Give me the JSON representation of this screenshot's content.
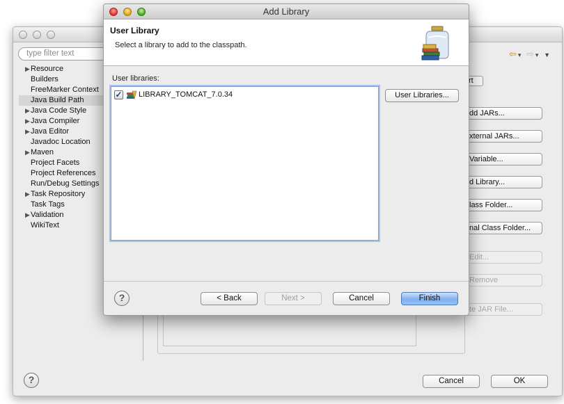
{
  "background_window": {
    "filter_placeholder": "type filter text",
    "tree": [
      {
        "label": "Resource",
        "expandable": true
      },
      {
        "label": "Builders",
        "expandable": false
      },
      {
        "label": "FreeMarker Context",
        "expandable": false
      },
      {
        "label": "Java Build Path",
        "expandable": false,
        "selected": true
      },
      {
        "label": "Java Code Style",
        "expandable": true
      },
      {
        "label": "Java Compiler",
        "expandable": true
      },
      {
        "label": "Java Editor",
        "expandable": true
      },
      {
        "label": "Javadoc Location",
        "expandable": false
      },
      {
        "label": "Maven",
        "expandable": true
      },
      {
        "label": "Project Facets",
        "expandable": false
      },
      {
        "label": "Project References",
        "expandable": false
      },
      {
        "label": "Run/Debug Settings",
        "expandable": false
      },
      {
        "label": "Task Repository",
        "expandable": true
      },
      {
        "label": "Task Tags",
        "expandable": false
      },
      {
        "label": "Validation",
        "expandable": true
      },
      {
        "label": "WikiText",
        "expandable": false
      }
    ],
    "tab_partial": "rt",
    "side_buttons": [
      {
        "label": "dd JARs...",
        "enabled": true
      },
      {
        "label": "xternal JARs...",
        "enabled": true
      },
      {
        "label": "Variable...",
        "enabled": true
      },
      {
        "label": "d Library...",
        "enabled": true
      },
      {
        "label": "lass Folder...",
        "enabled": true
      },
      {
        "label": "nal Class Folder...",
        "enabled": true
      },
      {
        "label": "Edit...",
        "enabled": false
      },
      {
        "label": "Remove",
        "enabled": false
      },
      {
        "label": "te JAR File...",
        "enabled": false
      }
    ],
    "help_glyph": "?",
    "cancel_label": "Cancel",
    "ok_label": "OK"
  },
  "dialog": {
    "window_title": "Add Library",
    "header_title": "User Library",
    "header_subtitle": "Select a library to add to the classpath.",
    "list_label": "User libraries:",
    "libraries": [
      {
        "name": "LIBRARY_TOMCAT_7.0.34",
        "checked": true
      }
    ],
    "user_libraries_button": "User Libraries...",
    "help_glyph": "?",
    "back_label": "< Back",
    "next_label": "Next >",
    "cancel_label": "Cancel",
    "finish_label": "Finish",
    "colors": {
      "default_button": "#7fb0ef",
      "list_focus": "#a9c3e8"
    }
  }
}
